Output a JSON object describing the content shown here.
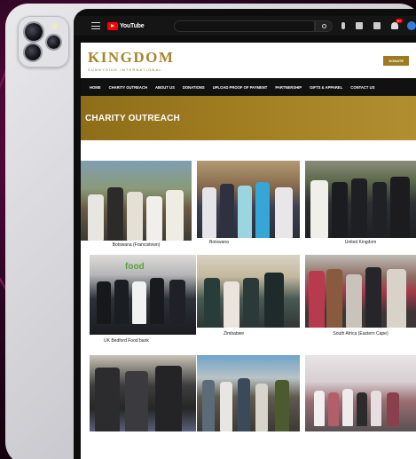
{
  "youtube": {
    "logo_text": "YouTube",
    "notifications_count": "9+"
  },
  "site": {
    "logo_main": "KINGDOM",
    "logo_sub": "SUNNYSIDE INTERNATIONAL",
    "donate_label": "DONATE",
    "nav": [
      "HOME",
      "CHARITY OUTREACH",
      "ABOUT US",
      "DONATIONS",
      "UPLOAD PROOF OF PAYMENT",
      "PARTNERSHIP",
      "GIFTS & APPAREL",
      "CONTACT US"
    ],
    "hero_title": "CHARITY OUTREACH"
  },
  "gallery": {
    "items": [
      {
        "caption": "Botswana (Francistown)"
      },
      {
        "caption": "Botswana"
      },
      {
        "caption": "United Kingdom"
      },
      {
        "caption": "UK Bedford Food bank",
        "sign_text": "food"
      },
      {
        "caption": "Zimbabwe"
      },
      {
        "caption": "South Africa (Eastern Cape)"
      },
      {
        "caption": ""
      },
      {
        "caption": ""
      },
      {
        "caption": ""
      }
    ]
  },
  "colors": {
    "brand_gold": "#a9852b",
    "nav_bg": "#111111",
    "hero_gold": "#a07d21",
    "youtube_red": "#ff0000"
  }
}
